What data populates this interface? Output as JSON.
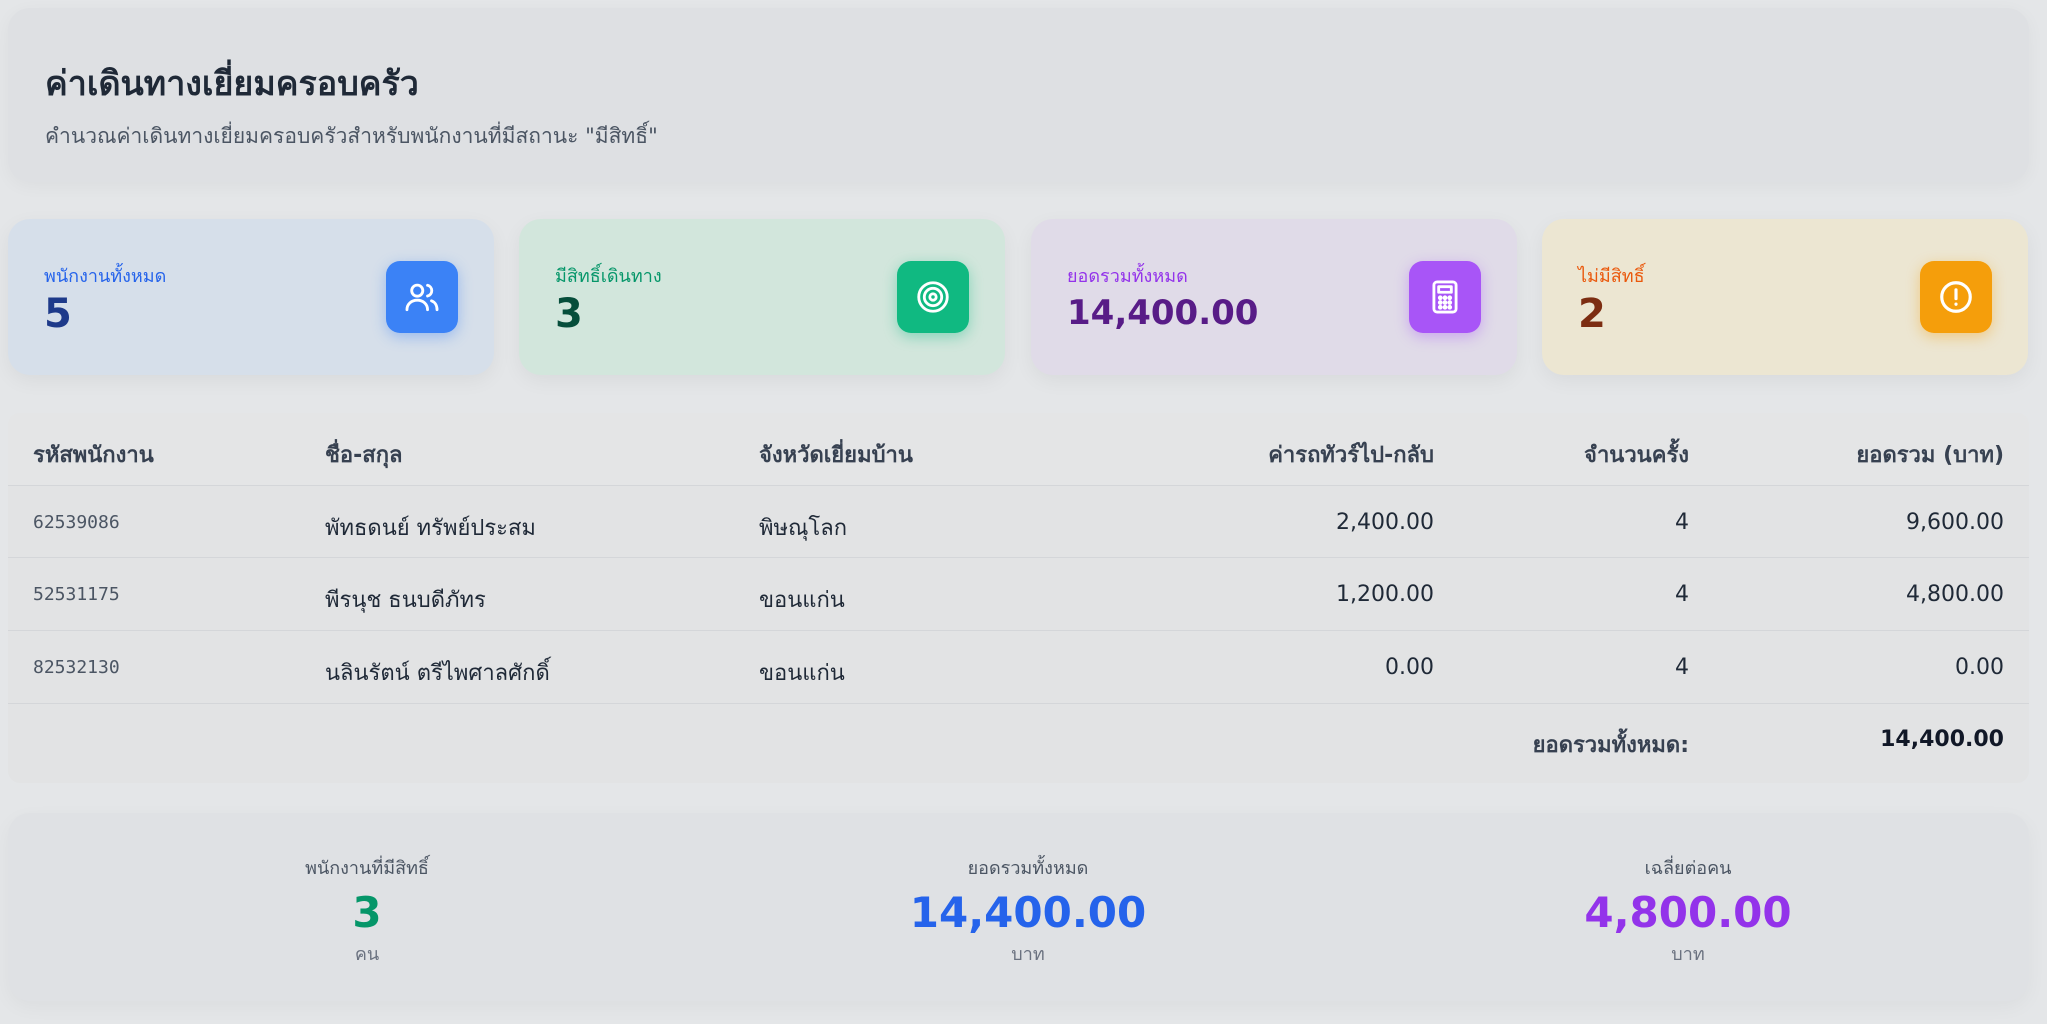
{
  "header": {
    "title": "ค่าเดินทางเยี่ยมครอบครัว",
    "subtitle": "คำนวณค่าเดินทางเยี่ยมครอบครัวสำหรับพนักงานที่มีสถานะ \"มีสิทธิ์\""
  },
  "stats": [
    {
      "label": "พนักงานทั้งหมด",
      "value": "5",
      "icon": "users-icon",
      "color": "#3b82f6"
    },
    {
      "label": "มีสิทธิ์เดินทาง",
      "value": "3",
      "icon": "target-icon",
      "color": "#10b981"
    },
    {
      "label": "ยอดรวมทั้งหมด",
      "value": "14,400.00",
      "icon": "calculator-icon",
      "color": "#a855f7"
    },
    {
      "label": "ไม่มีสิทธิ์",
      "value": "2",
      "icon": "alert-circle-icon",
      "color": "#f59e0b"
    }
  ],
  "table": {
    "headers": {
      "id": "รหัสพนักงาน",
      "name": "ชื่อ-สกุล",
      "province": "จังหวัดเยี่ยมบ้าน",
      "fare": "ค่ารถทัวร์ไป-กลับ",
      "count": "จำนวนครั้ง",
      "total": "ยอดรวม (บาท)"
    },
    "rows": [
      {
        "id": "62539086",
        "name": "พัทธดนย์ ทรัพย์ประสม",
        "province": "พิษณุโลก",
        "fare": "2,400.00",
        "count": "4",
        "total": "9,600.00"
      },
      {
        "id": "52531175",
        "name": "พีรนุช ธนบดีภัทร",
        "province": "ขอนแก่น",
        "fare": "1,200.00",
        "count": "4",
        "total": "4,800.00"
      },
      {
        "id": "82532130",
        "name": "นลินรัตน์ ตรีไพศาลศักดิ์",
        "province": "ขอนแก่น",
        "fare": "0.00",
        "count": "4",
        "total": "0.00"
      }
    ],
    "footer": {
      "label": "ยอดรวมทั้งหมด:",
      "value": "14,400.00"
    }
  },
  "summary": [
    {
      "label": "พนักงานที่มีสิทธิ์",
      "value": "3",
      "unit": "คน"
    },
    {
      "label": "ยอดรวมทั้งหมด",
      "value": "14,400.00",
      "unit": "บาท"
    },
    {
      "label": "เฉลี่ยต่อคน",
      "value": "4,800.00",
      "unit": "บาท"
    }
  ]
}
